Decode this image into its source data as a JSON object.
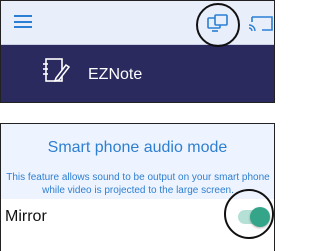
{
  "app_panel": {
    "toolbar": {
      "menu_icon": "hamburger-icon",
      "mirror_icon": "mirror-screen-icon",
      "cast_icon": "cast-icon",
      "accent_color": "#2a7fd4"
    },
    "app_item": {
      "icon": "note-edit-icon",
      "name": "EZNote"
    }
  },
  "settings_panel": {
    "title": "Smart phone audio mode",
    "description": "This feature allows sound to be output on your smart phone while video is projected to the large screen.",
    "mirror_setting": {
      "label": "Mirror",
      "enabled": true,
      "toggle_color": "#35a58a"
    }
  }
}
